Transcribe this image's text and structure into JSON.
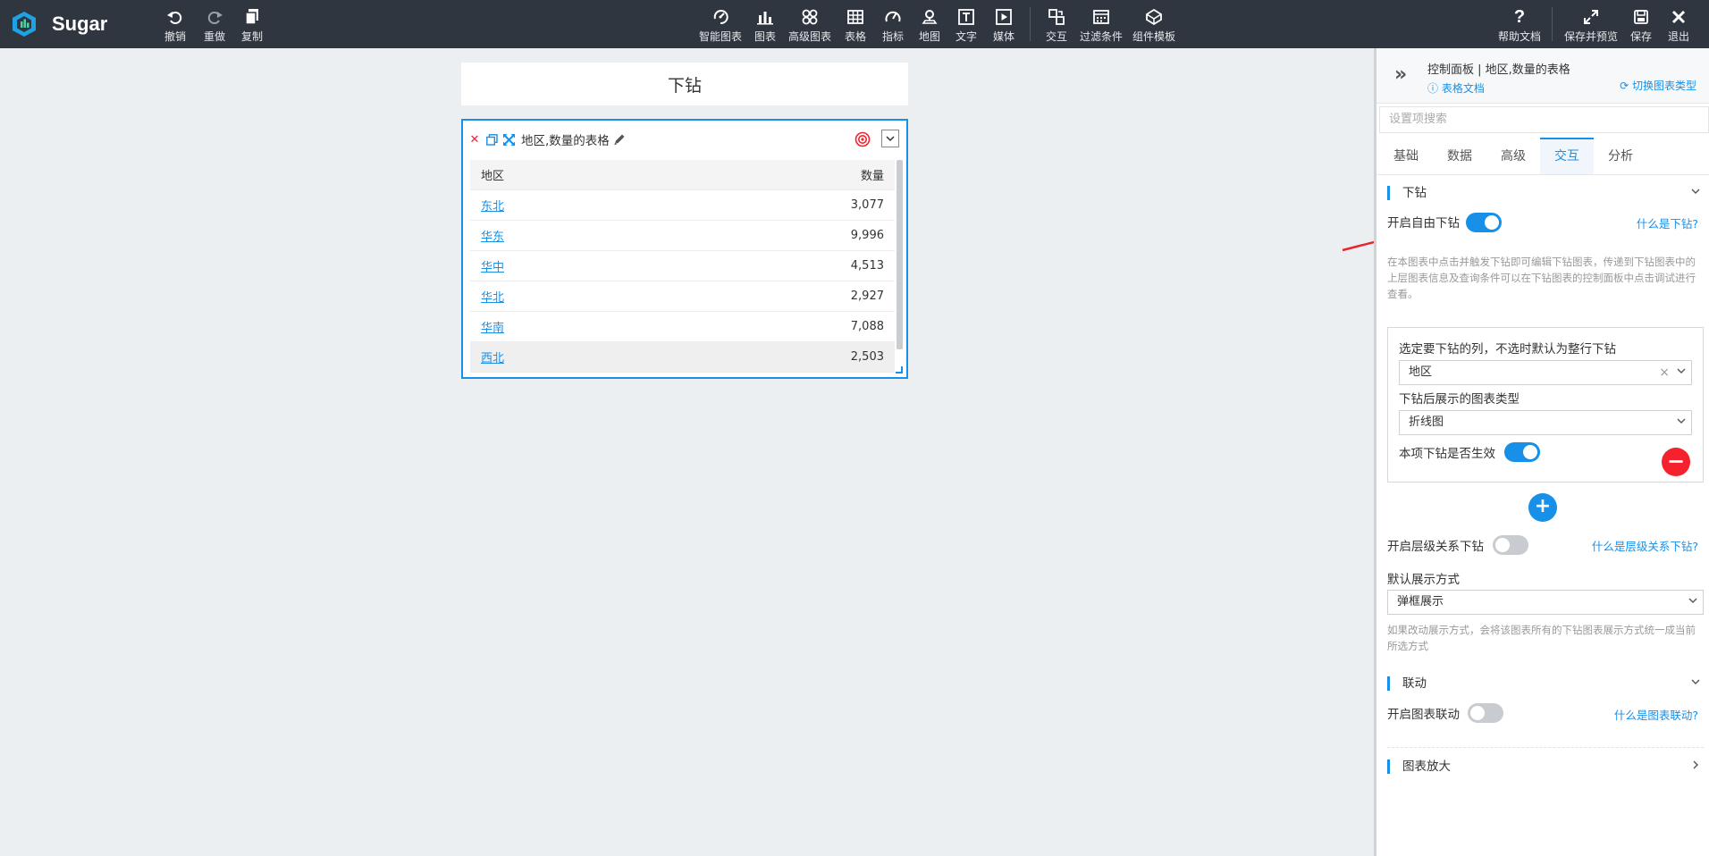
{
  "app": {
    "name": "Sugar"
  },
  "toolbar": {
    "left": [
      {
        "label": "撤销",
        "icon": "undo-icon"
      },
      {
        "label": "重做",
        "icon": "redo-icon"
      },
      {
        "label": "复制",
        "icon": "copy-icon"
      }
    ],
    "center": [
      {
        "label": "智能图表",
        "icon": "smart-chart-icon"
      },
      {
        "label": "图表",
        "icon": "bar-chart-icon"
      },
      {
        "label": "高级图表",
        "icon": "advanced-chart-icon"
      },
      {
        "label": "表格",
        "icon": "table-icon"
      },
      {
        "label": "指标",
        "icon": "gauge-icon"
      },
      {
        "label": "地图",
        "icon": "map-pin-icon"
      },
      {
        "label": "文字",
        "icon": "text-icon"
      },
      {
        "label": "媒体",
        "icon": "media-icon"
      },
      {
        "label": "交互",
        "icon": "interaction-icon"
      },
      {
        "label": "过滤条件",
        "icon": "filter-icon"
      },
      {
        "label": "组件模板",
        "icon": "template-icon"
      }
    ],
    "right": [
      {
        "label": "帮助文档",
        "icon": "help-icon"
      },
      {
        "label": "保存并预览",
        "icon": "expand-icon"
      },
      {
        "label": "保存",
        "icon": "save-icon"
      },
      {
        "label": "退出",
        "icon": "close-icon"
      }
    ]
  },
  "canvas": {
    "title": "下钻",
    "chart": {
      "title": "地区,数量的表格",
      "columns": [
        "地区",
        "数量"
      ],
      "rows": [
        {
          "region": "东北",
          "value": "3,077"
        },
        {
          "region": "华东",
          "value": "9,996"
        },
        {
          "region": "华中",
          "value": "4,513"
        },
        {
          "region": "华北",
          "value": "2,927"
        },
        {
          "region": "华南",
          "value": "7,088"
        },
        {
          "region": "西北",
          "value": "2,503"
        }
      ]
    }
  },
  "panel": {
    "title": "控制面板 | 地区,数量的表格",
    "doc_link": "表格文档",
    "switch_type": "切换图表类型",
    "search_placeholder": "设置项搜索",
    "tabs": [
      "基础",
      "数据",
      "高级",
      "交互",
      "分析"
    ],
    "active_tab": "交互",
    "drilldown": {
      "section_title": "下钻",
      "free_drill_label": "开启自由下钻",
      "free_drill_on": true,
      "what_link": "什么是下钻?",
      "description": "在本图表中点击并触发下钻即可编辑下钻图表，传递到下钻图表中的上层图表信息及查询条件可以在下钻图表的控制面板中点击调试进行查看。",
      "select_column_label": "选定要下钻的列，不选时默认为整行下钻",
      "select_column_value": "地区",
      "chart_type_label": "下钻后展示的图表类型",
      "chart_type_value": "折线图",
      "enabled_label": "本项下钻是否生效",
      "enabled_on": true,
      "hierarchy_label": "开启层级关系下钻",
      "hierarchy_on": false,
      "hierarchy_link": "什么是层级关系下钻?",
      "display_label": "默认展示方式",
      "display_value": "弹框展示",
      "display_desc": "如果改动展示方式，会将该图表所有的下钻图表展示方式统一成当前所选方式"
    },
    "linkage": {
      "section_title": "联动",
      "label": "开启图表联动",
      "on": false,
      "link": "什么是图表联动?"
    },
    "zoom": {
      "section_title": "图表放大"
    }
  },
  "colors": {
    "accent": "#1890e8",
    "topbar": "#303640",
    "danger": "#f5222d"
  }
}
